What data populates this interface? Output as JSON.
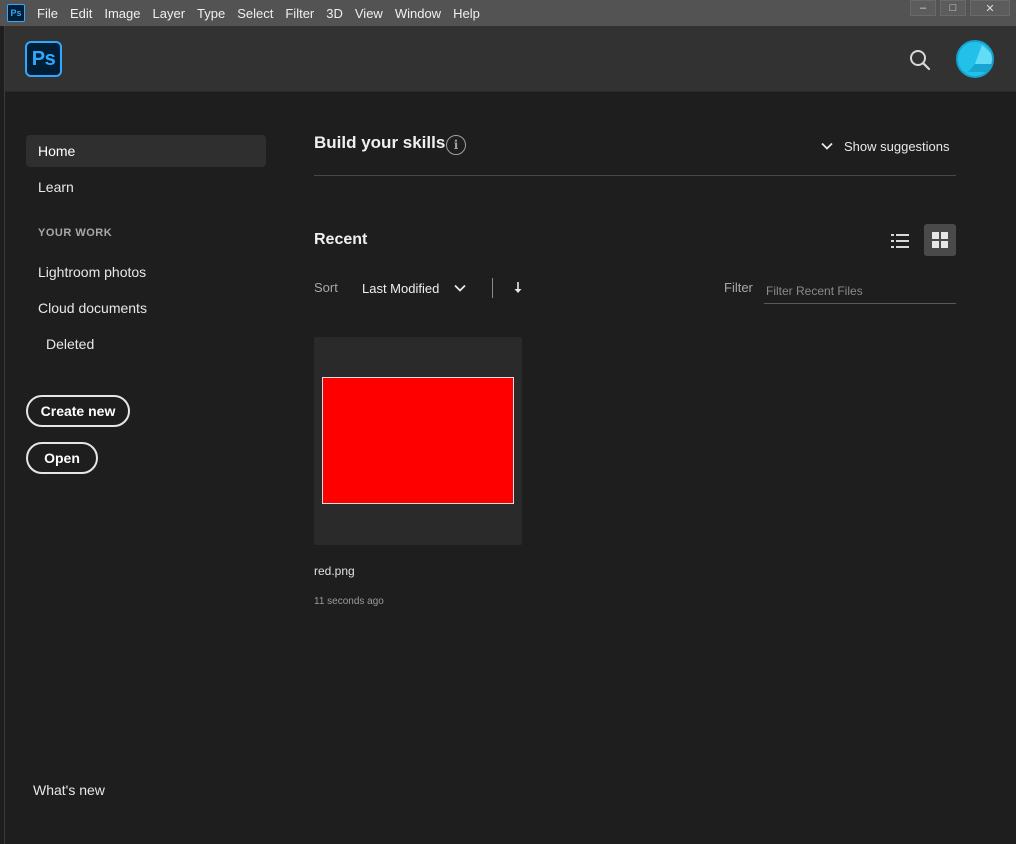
{
  "menubar": {
    "app_icon_text": "Ps",
    "items": [
      "File",
      "Edit",
      "Image",
      "Layer",
      "Type",
      "Select",
      "Filter",
      "3D",
      "View",
      "Window",
      "Help"
    ],
    "window_controls": {
      "minimize": "–",
      "maximize": "□",
      "close": "✕"
    }
  },
  "header": {
    "logo_text": "Ps",
    "search_icon": "search-icon",
    "avatar_icon": "user-avatar"
  },
  "sidebar": {
    "home_label": "Home",
    "learn_label": "Learn",
    "section_label": "YOUR WORK",
    "lightroom_label": "Lightroom photos",
    "cloud_label": "Cloud documents",
    "deleted_label": "Deleted",
    "create_new_label": "Create new",
    "open_label": "Open",
    "whats_new_label": "What's new"
  },
  "skills": {
    "title": "Build your skills",
    "info_icon_text": "i",
    "suggestions_label": "Show suggestions"
  },
  "recent": {
    "title": "Recent",
    "list_view_icon": "list-view-icon",
    "grid_view_icon": "grid-view-icon",
    "sort_label": "Sort",
    "sort_value": "Last Modified",
    "sort_direction_icon": "arrow-down-icon",
    "filter_label": "Filter",
    "filter_placeholder": "Filter Recent Files",
    "filter_value": "",
    "files": [
      {
        "name": "red.png",
        "modified": "11 seconds ago",
        "thumbnail_color": "#ff0000"
      }
    ]
  },
  "colors": {
    "accent": "#31a8ff",
    "background": "#1e1e1e",
    "header": "#323232",
    "menubar": "#535353",
    "avatar": "#23c1ea"
  }
}
